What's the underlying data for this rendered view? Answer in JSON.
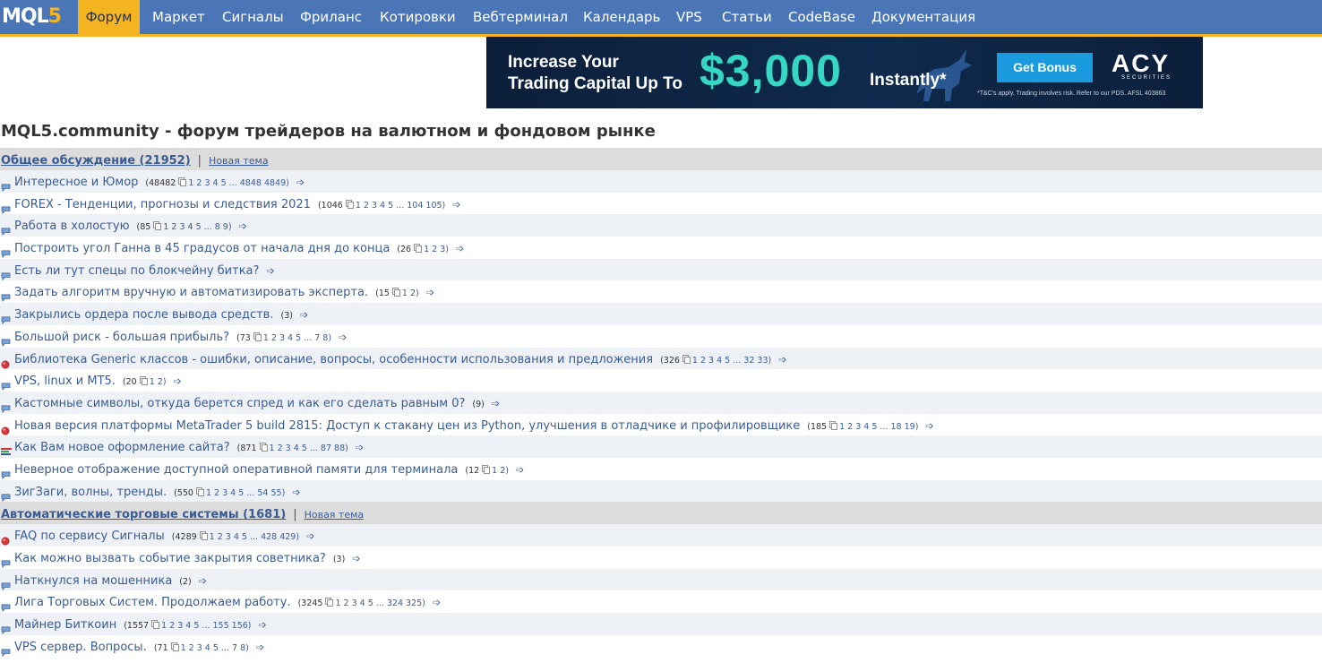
{
  "logo": {
    "text": "MQL",
    "five": "5"
  },
  "nav": {
    "items": [
      {
        "label": "Форум",
        "active": true
      },
      {
        "label": "Маркет"
      },
      {
        "label": "Сигналы"
      },
      {
        "label": "Фриланс"
      },
      {
        "label": "Котировки"
      },
      {
        "label": "Вебтерминал"
      },
      {
        "label": "Календарь"
      },
      {
        "label": "VPS"
      },
      {
        "label": "Статьи"
      },
      {
        "label": "CodeBase"
      },
      {
        "label": "Документация"
      }
    ]
  },
  "banner": {
    "line1": "Increase Your",
    "line2": "Trading Capital Up To",
    "amount": "$3,000",
    "instantly": "Instantly*",
    "button": "Get Bonus",
    "brand": "ACY",
    "brand_sub": "SECURITIES",
    "disclaimer": "*T&C's apply. Trading involves risk. Refer to our PDS. AFSL 403863",
    "colors": {
      "background": "#0c1f3b",
      "amount": "#35d6c4",
      "button": "#1a9be0"
    }
  },
  "page_title": "MQL5.community - форум трейдеров на валютном и фондовом рынке",
  "sections": [
    {
      "title": "Общее обсуждение (21952)",
      "separator": "|",
      "new_topic": "Новая тема",
      "topics": [
        {
          "icon": "speech-bubble-icon",
          "title": "Интересное и Юмор",
          "count": "(48482",
          "pages": "1 2 3 4 5 ... 4848 4849)"
        },
        {
          "icon": "speech-bubble-icon",
          "title": "FOREX - Тенденции, прогнозы и следствия 2021",
          "count": "(1046",
          "pages": "1 2 3 4 5 ... 104 105)"
        },
        {
          "icon": "speech-bubble-icon",
          "title": "Работа в холостую",
          "count": "(85",
          "pages": "1 2 3 4 5 ... 8 9)"
        },
        {
          "icon": "speech-bubble-icon",
          "title": "Построить угол Ганна в 45 градусов от начала дня до конца",
          "count": "(26",
          "pages": "1 2 3)"
        },
        {
          "icon": "speech-bubble-icon",
          "title": "Есть ли тут спецы по блокчейну битка?",
          "count": "",
          "pages": ""
        },
        {
          "icon": "speech-bubble-icon",
          "title": "Задать алгоритм вручную и автоматизировать эксперта.",
          "count": "(15",
          "pages": "1 2)"
        },
        {
          "icon": "speech-bubble-icon",
          "title": "Закрылись ордера после вывода средств.",
          "count": "(3)",
          "pages": ""
        },
        {
          "icon": "speech-bubble-icon",
          "title": "Большой риск - большая прибыль?",
          "count": "(73",
          "pages": "1 2 3 4 5 ... 7 8)"
        },
        {
          "icon": "pinned-dot-icon",
          "title": "Библиотека Generic классов - ошибки, описание, вопросы, особенности использования и предложения",
          "count": "(326",
          "pages": "1 2 3 4 5 ... 32 33)"
        },
        {
          "icon": "speech-bubble-icon",
          "title": "VPS, linux и МТ5.",
          "count": "(20",
          "pages": "1 2)"
        },
        {
          "icon": "speech-bubble-icon",
          "title": "Кастомные символы, откуда берется спред и как его сделать равным 0?",
          "count": "(9)",
          "pages": ""
        },
        {
          "icon": "pinned-dot-icon",
          "title": "Новая версия платформы MetaTrader 5 build 2815: Доступ к стакану цен из Python, улучшения в отладчике и профилировщике",
          "count": "(185",
          "pages": "1 2 3 4 5 ... 18 19)"
        },
        {
          "icon": "poll-icon",
          "title": "Как Вам новое оформление сайта?",
          "count": "(871",
          "pages": "1 2 3 4 5 ... 87 88)"
        },
        {
          "icon": "speech-bubble-icon",
          "title": "Неверное отображение доступной оперативной памяти для терминала",
          "count": "(12",
          "pages": "1 2)"
        },
        {
          "icon": "speech-bubble-icon",
          "title": "ЗигЗаги, волны, тренды.",
          "count": "(550",
          "pages": "1 2 3 4 5 ... 54 55)"
        }
      ]
    },
    {
      "title": "Автоматические торговые системы (1681)",
      "separator": "|",
      "new_topic": "Новая тема",
      "topics": [
        {
          "icon": "pinned-dot-icon",
          "title": "FAQ по сервису Сигналы",
          "count": "(4289",
          "pages": "1 2 3 4 5 ... 428 429)"
        },
        {
          "icon": "speech-bubble-icon",
          "title": "Как можно вызвать событие закрытия советника?",
          "count": "(3)",
          "pages": ""
        },
        {
          "icon": "speech-bubble-icon",
          "title": "Наткнулся на мошенника",
          "count": "(2)",
          "pages": ""
        },
        {
          "icon": "speech-bubble-icon",
          "title": "Лига Торговых Систем. Продолжаем работу.",
          "count": "(3245",
          "pages": "1 2 3 4 5 ... 324 325)"
        },
        {
          "icon": "speech-bubble-icon",
          "title": "Майнер Биткоин",
          "count": "(1557",
          "pages": "1 2 3 4 5 ... 155 156)"
        },
        {
          "icon": "speech-bubble-icon",
          "title": "VPS сервер. Вопросы.",
          "count": "(71",
          "pages": "1 2 3 4 5 ... 7 8)"
        }
      ]
    }
  ],
  "colors": {
    "nav_bg": "#4a76b8",
    "nav_active": "#f4b321",
    "link": "#3a5c94",
    "section_bg": "#dcdcdc",
    "row_alt": "#eef1f6"
  }
}
